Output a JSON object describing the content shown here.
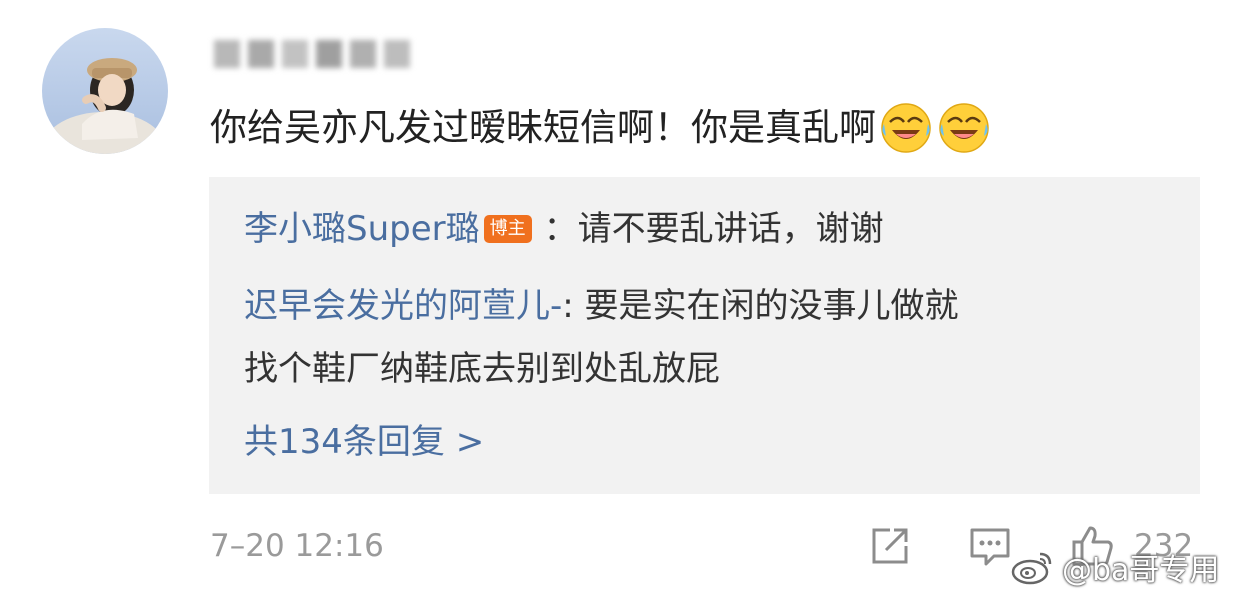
{
  "comment": {
    "username": "娜娜好梦话",
    "text": "你给吴亦凡发过暧昧短信啊！你是真乱啊",
    "emojis": [
      "laugh-cry-emoji",
      "laugh-cry-emoji"
    ]
  },
  "replies": [
    {
      "author": "李小璐Super璐",
      "badge": "博主",
      "separator": "：",
      "text": "请不要乱讲话，谢谢"
    },
    {
      "author": "迟早会发光的阿萱儿-",
      "separator": ":",
      "text_line1": " 要是实在闲的没事儿做就",
      "text_line2": "找个鞋厂纳鞋底去别到处乱放屁"
    }
  ],
  "more_replies": "共134条回复 >",
  "footer": {
    "timestamp": "7–20 12:16",
    "icons": [
      "share-icon",
      "comment-icon",
      "like-icon"
    ],
    "like_count": "232"
  },
  "watermark": "@ba哥专用",
  "colors": {
    "link": "#4a6ea0",
    "badge": "#f0701e",
    "reply_bg": "#f2f2f2",
    "meta": "#9a9a9a"
  }
}
